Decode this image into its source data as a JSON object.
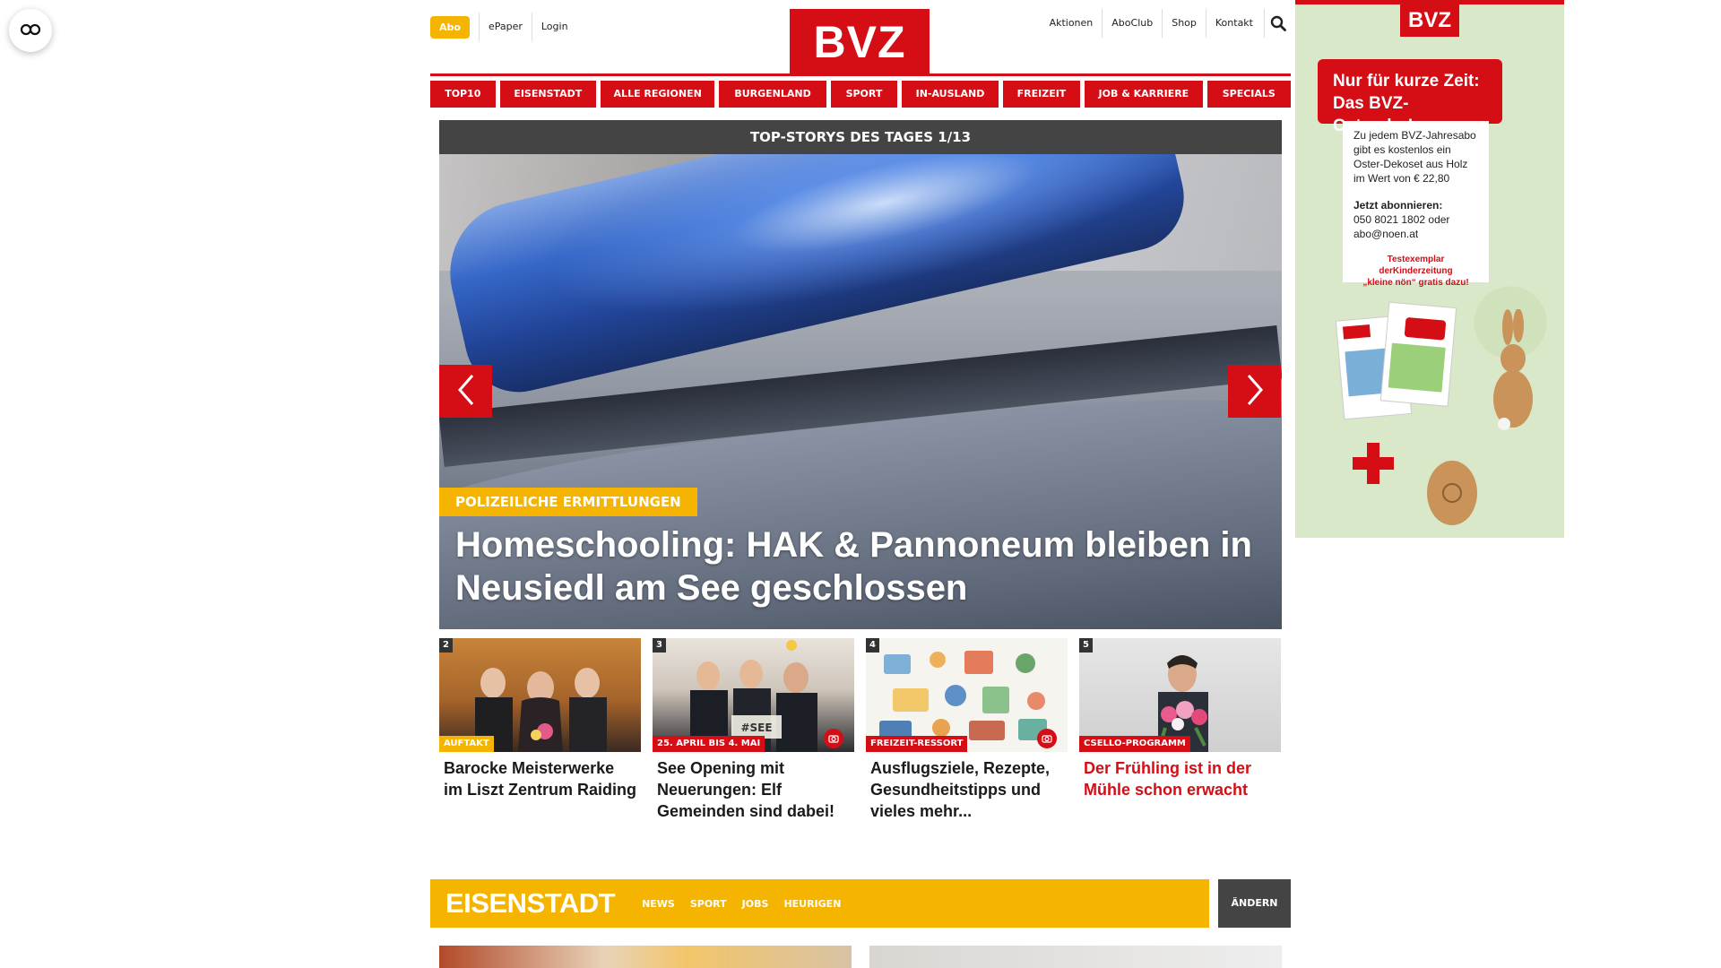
{
  "header": {
    "abo": "Abo",
    "left_links": [
      "ePaper",
      "Login"
    ],
    "logo": "BVZ",
    "right_links": [
      "Aktionen",
      "AboClub",
      "Shop",
      "Kontakt"
    ]
  },
  "nav": [
    "TOP10",
    "EISENSTADT",
    "ALLE REGIONEN",
    "BURGENLAND",
    "SPORT",
    "IN-AUSLAND",
    "FREIZEIT",
    "JOB & KARRIERE",
    "SPECIALS"
  ],
  "top_stories": {
    "bar_label": "TOP-STORYS DES TAGES 1/13",
    "hero_tag": "POLIZEILICHE ERMITTLUNGEN",
    "hero_title": "Homeschooling: HAK & Pannoneum bleiben in Neusiedl am See geschlossen"
  },
  "cards": [
    {
      "num": "2",
      "tag": "AUFTAKT",
      "tag_color": "#f5b400",
      "title": "Barocke Meisterwerke im Liszt Zentrum Raiding"
    },
    {
      "num": "3",
      "tag": "25. APRIL BIS 4. MAI",
      "tag_color": "#d50d15",
      "title": "See Opening mit Neuerungen: Elf Gemeinden sind dabei!"
    },
    {
      "num": "4",
      "tag": "FREIZEIT-RESSORT",
      "tag_color": "#d50d15",
      "title": "Ausflugsziele, Rezepte, Gesundheitstipps und vieles mehr..."
    },
    {
      "num": "5",
      "tag": "CSELLO-PROGRAMM",
      "tag_color": "#d50d15",
      "title": "Der Frühling ist in der Mühle schon erwacht"
    }
  ],
  "section": {
    "title": "EISENSTADT",
    "links": [
      "NEWS",
      "SPORT",
      "JOBS",
      "HEURIGEN"
    ],
    "change": "ÄNDERN"
  },
  "ad": {
    "logo": "BVZ",
    "headline_1": "Nur für kurze Zeit:",
    "headline_2": "Das BVZ-Osterabo!",
    "body_1": "Zu jedem BVZ-Jahresabo",
    "body_2": "gibt es kostenlos ein",
    "body_3": "Oster-Dekoset aus Holz",
    "body_4": "im Wert von € 22,80",
    "cta": "Jetzt abonnieren:",
    "phone": "050 8021 1802 oder",
    "email": "abo@noen.at",
    "note_1": "Testexemplar derKinderzeitung",
    "note_2": "„kleine nön“ gratis dazu!"
  },
  "colors": {
    "brand_red": "#d50d15",
    "accent_yellow": "#f5b400",
    "dark_bar": "#444444"
  }
}
